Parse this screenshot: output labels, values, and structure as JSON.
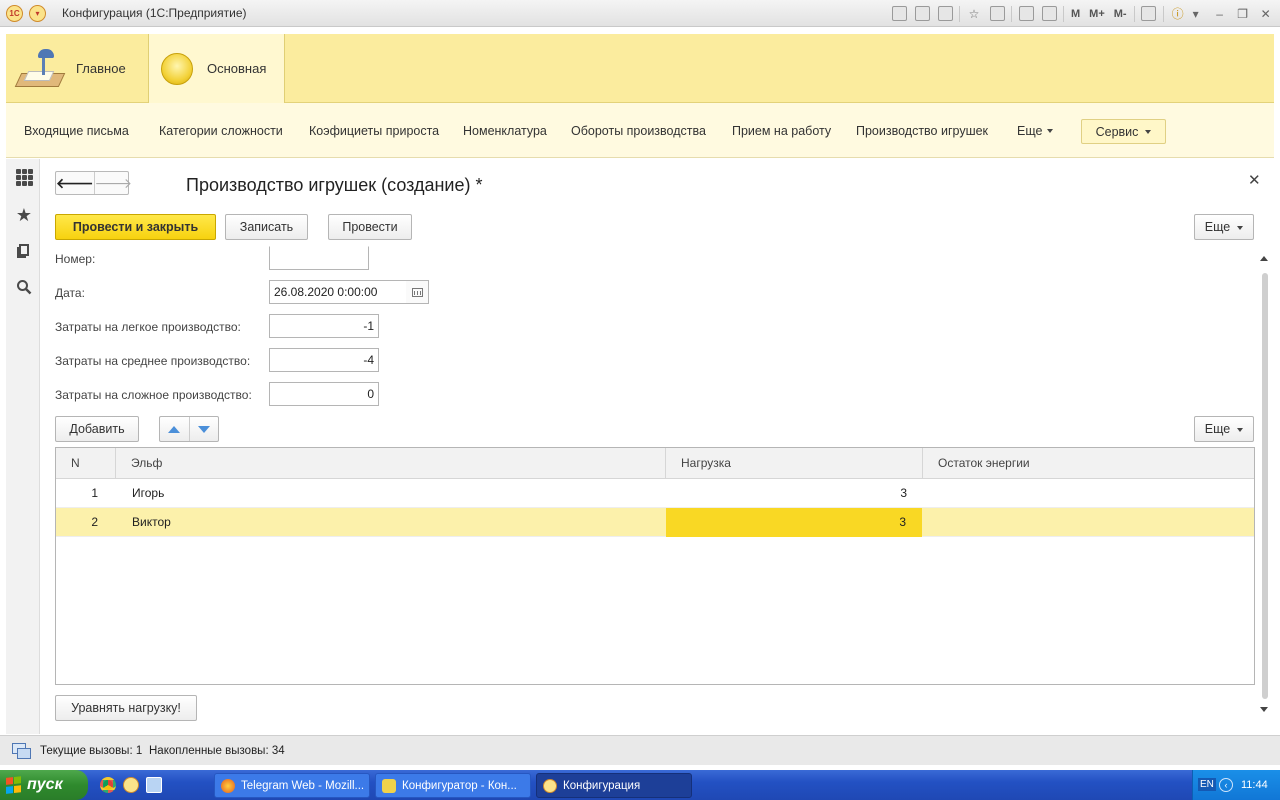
{
  "window": {
    "title": "Конфигурация (1С:Предприятие)",
    "tool_labels": [
      "M",
      "M+",
      "M-"
    ]
  },
  "sections": [
    {
      "label": "Главное",
      "icon": "desk-lamp-icon",
      "active": false
    },
    {
      "label": "Основная",
      "icon": "yellow-orb-icon",
      "active": true
    }
  ],
  "navigation": {
    "items": [
      "Входящие письма",
      "Категории сложности",
      "Коэфициеты прироста",
      "Номенклатура",
      "Обороты производства",
      "Прием на работу",
      "Производство игрушек"
    ],
    "more_label": "Еще",
    "service_label": "Сервис"
  },
  "form": {
    "title": "Производство игрушек (создание) *",
    "buttons": {
      "post_and_close": "Провести и закрыть",
      "save": "Записать",
      "post": "Провести",
      "more": "Еще"
    },
    "fields": {
      "number_label": "Номер:",
      "number_value": "",
      "date_label": "Дата:",
      "date_value": "26.08.2020  0:00:00",
      "easy_label": "Затраты на легкое производство:",
      "easy_value": "-1",
      "medium_label": "Затраты на среднее производство:",
      "medium_value": "-4",
      "hard_label": "Затраты на сложное производство:",
      "hard_value": "0"
    },
    "table_toolbar": {
      "add_label": "Добавить",
      "more_label": "Еще"
    },
    "table": {
      "columns": [
        "N",
        "Эльф",
        "Нагрузка",
        "Остаток энергии"
      ],
      "rows": [
        {
          "n": "1",
          "elf": "Игорь",
          "load": "3",
          "energy": ""
        },
        {
          "n": "2",
          "elf": "Виктор",
          "load": "3",
          "energy": ""
        }
      ]
    },
    "equalize_label": "Уравнять нагрузку!"
  },
  "status": {
    "current_calls": "Текущие вызовы: 1",
    "accumulated_calls": "Накопленные вызовы: 34"
  },
  "taskbar": {
    "start_label": "пуск",
    "tasks": [
      "Telegram Web - Mozill...",
      "Конфигуратор - Кон...",
      "Конфигурация"
    ],
    "lang": "EN",
    "clock": "11:44"
  },
  "colors": {
    "sections_bg": "#fbec9e",
    "primary_button": "#f7d20f",
    "selected_row": "#fcf1ab",
    "current_cell": "#f9d824",
    "taskbar": "#2351c3"
  }
}
